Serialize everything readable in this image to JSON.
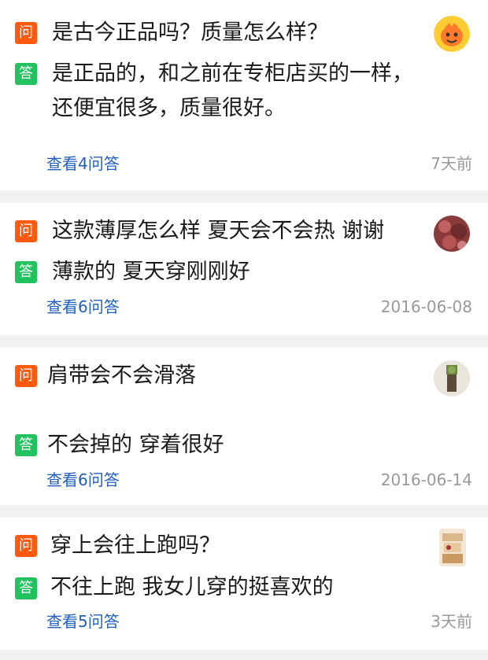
{
  "questions": [
    {
      "question": "是古今正品吗？质量怎么样？",
      "answer_line1": "是正品的，和之前在专柜店买的一样，",
      "answer_line2": "还便宜很多，质量很好。",
      "link": "查看4问答",
      "time": "7天前"
    },
    {
      "question": "这款薄厚怎么样 夏天会不会热 谢谢",
      "answer": "薄款的 夏天穿刚刚好",
      "link": "查看6问答",
      "time": "2016-06-08"
    },
    {
      "question": "肩带会不会滑落",
      "answer": "不会掉的 穿着很好",
      "link": "查看6问答",
      "time": "2016-06-14"
    },
    {
      "question": "穿上会往上跑吗？",
      "answer": "不往上跑 我女儿穿的挺喜欢的",
      "link": "查看5问答",
      "time": "3天前"
    }
  ],
  "badges": {
    "question": "问",
    "answer": "答"
  },
  "colors": {
    "question_badge": "#ff5a10",
    "answer_badge": "#22c25e",
    "link": "#1f5fbf"
  }
}
